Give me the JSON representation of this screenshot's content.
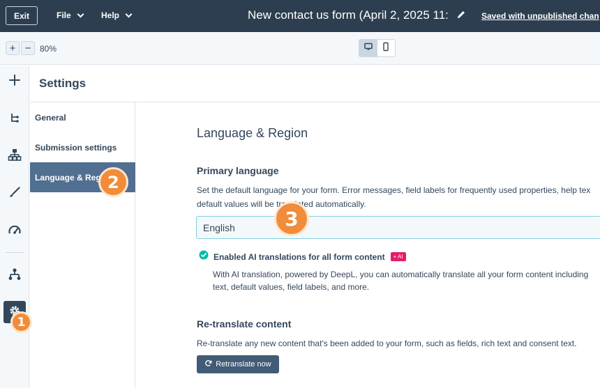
{
  "topbar": {
    "exit_label": "Exit",
    "file_label": "File",
    "help_label": "Help",
    "form_title": "New contact us form (April 2, 2025 11:",
    "saved_status": "Saved with unpublished chan"
  },
  "zoom": {
    "plus": "+",
    "minus": "−",
    "level": "80%"
  },
  "rail": {
    "icons": [
      "plus-icon",
      "tree-icon",
      "hierarchy-icon",
      "brush-icon",
      "gauge-icon",
      "workflow-icon",
      "gear-icon"
    ]
  },
  "settings": {
    "title": "Settings",
    "nav": [
      {
        "label": "General"
      },
      {
        "label": "Submission settings"
      },
      {
        "label": "Language & Region"
      }
    ]
  },
  "content": {
    "heading": "Language & Region",
    "primary_language": {
      "label": "Primary language",
      "help_line1": "Set the default language for your form. Error messages, field labels for frequently used properties, help tex",
      "help_line2": "default values will be translated automatically.",
      "value": "English"
    },
    "ai": {
      "label": "Enabled AI translations for all form content",
      "badge": "+ AI",
      "desc_line1": "With AI translation, powered by DeepL, you can automatically translate all your form content including",
      "desc_line2": "text, default values, field labels, and more."
    },
    "retranslate": {
      "heading": "Re-translate content",
      "desc": "Re-translate any new content that's been added to your form, such as fields, rich text and consent text.",
      "button_label": "Retranslate now"
    }
  },
  "steps": [
    "1",
    "2",
    "3"
  ],
  "colors": {
    "topbar": "#2d3e50",
    "active_nav": "#516f90",
    "step_marker": "#f08c3a",
    "ai_badge": "#e8196a",
    "check": "#00bda5"
  }
}
